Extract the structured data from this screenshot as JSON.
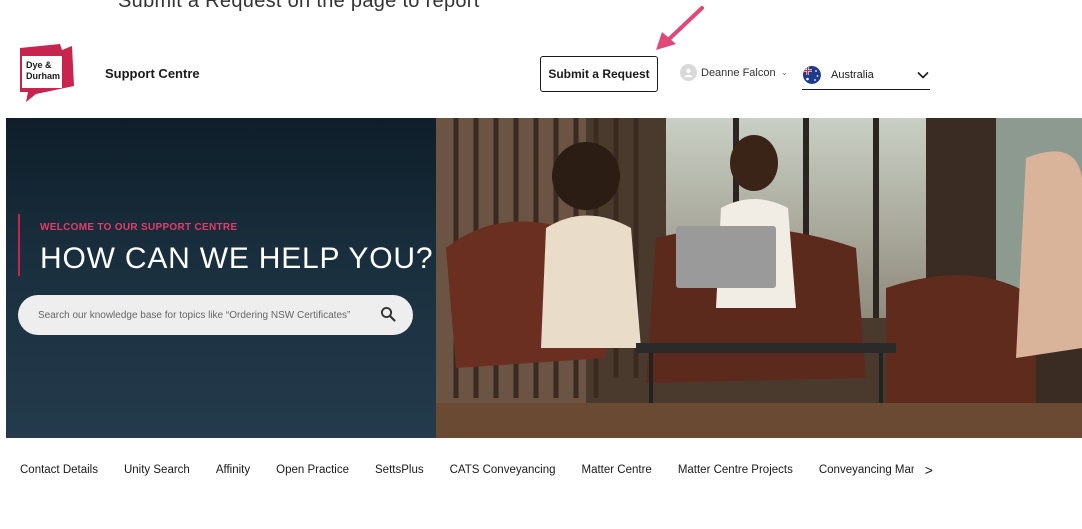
{
  "caption": {
    "text": "Submit a Request on the page to report"
  },
  "header": {
    "logo_text": [
      "Dye &",
      "Durham"
    ],
    "title": "Support Centre",
    "submit_label": "Submit a Request",
    "user_name": "Deanne Falcon",
    "country": "Australia"
  },
  "hero": {
    "welcome": "WELCOME TO OUR SUPPORT CENTRE",
    "headline": "HOW CAN WE HELP YOU?",
    "search_placeholder": "Search our knowledge base for topics like “Ordering NSW Certificates”"
  },
  "tabs": [
    "Contact Details",
    "Unity Search",
    "Affinity",
    "Open Practice",
    "SettsPlus",
    "CATS Conveyancing",
    "Matter Centre",
    "Matter Centre Projects",
    "Conveyancing Mana"
  ],
  "tabs_next": ">",
  "colors": {
    "accent": "#c7254e",
    "hero_dark": "#0f1e2a",
    "annotation_arrow": "#e0487a"
  },
  "icons": [
    "search-icon",
    "chevron-down-icon",
    "user-avatar-icon",
    "australia-flag-icon",
    "annotation-arrow-icon"
  ]
}
